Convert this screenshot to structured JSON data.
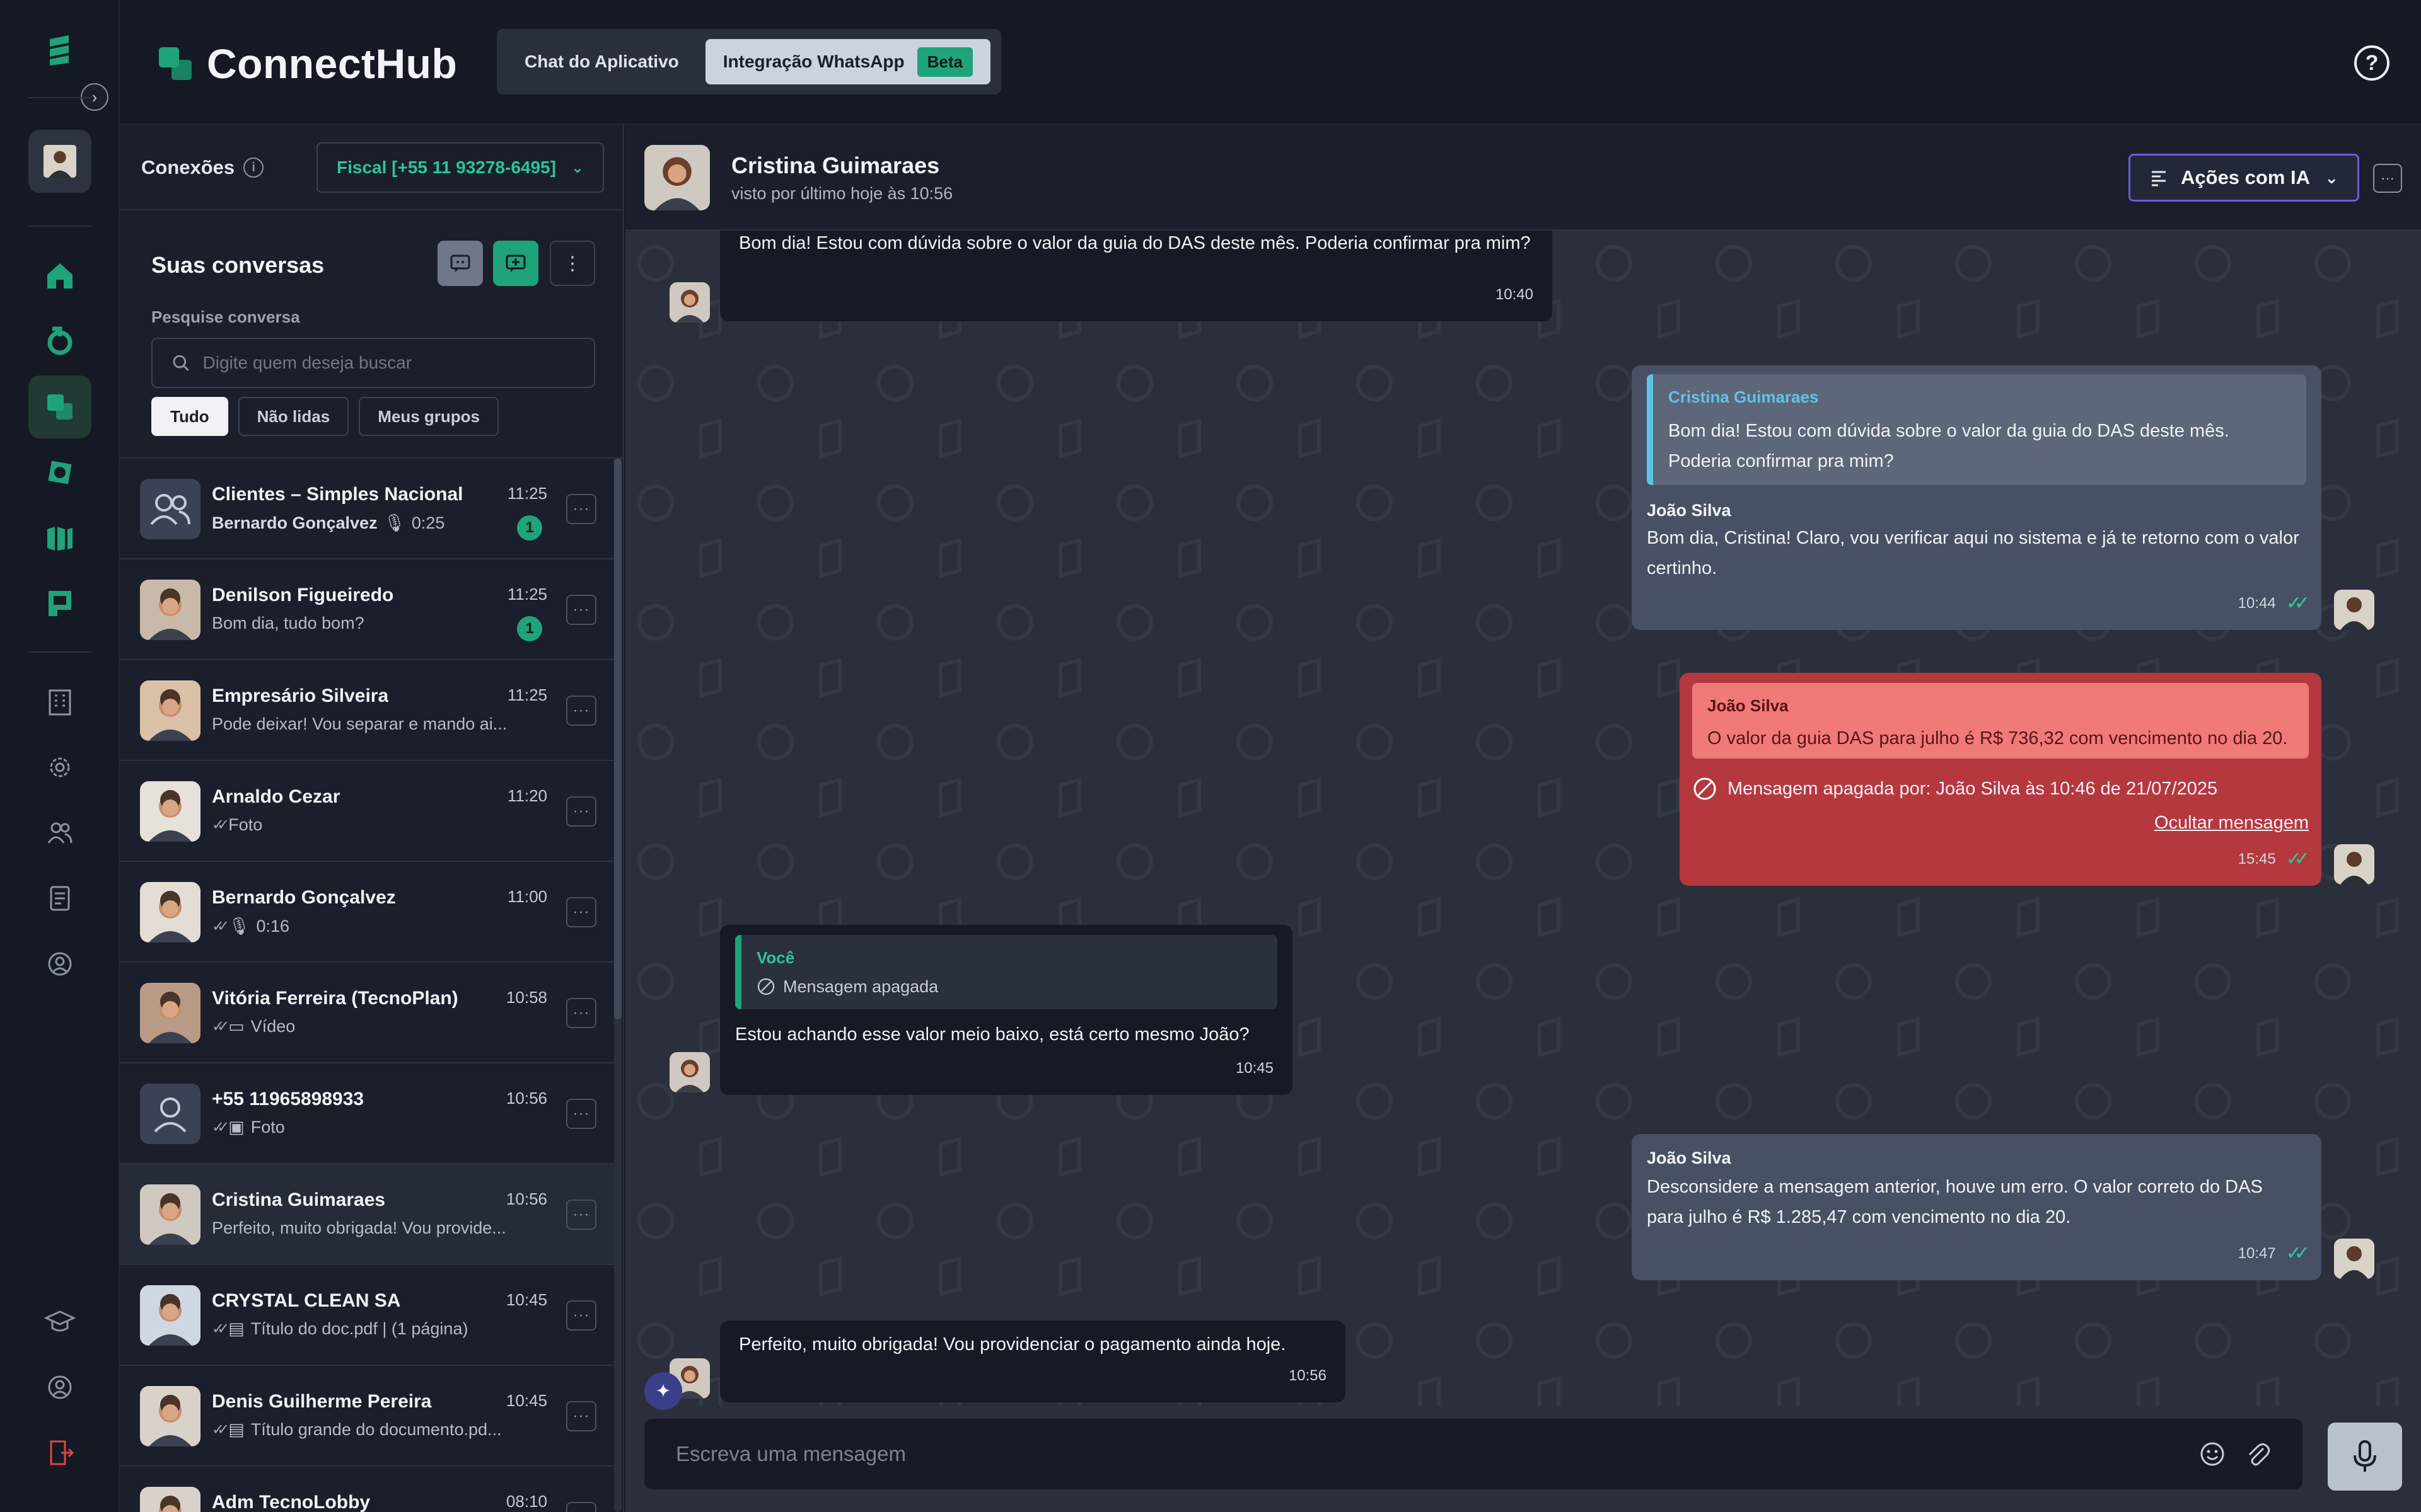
{
  "app": {
    "title": "ConnectHub",
    "colors": {
      "accent": "#1fa37a",
      "background": "#151923",
      "danger": "#b5383f",
      "ai": "#6b5ae0"
    }
  },
  "header": {
    "tabs": [
      {
        "label": "Chat do Aplicativo",
        "active": false
      },
      {
        "label": "Integração WhatsApp",
        "active": true,
        "badge": "Beta"
      }
    ],
    "help_icon": "help-circle-icon"
  },
  "rail": {
    "icons": [
      "logo-icon",
      "expand-icon",
      "user-avatar",
      "home-icon",
      "refresh-icon",
      "connecthub-icon",
      "cycle-icon",
      "board-icon",
      "chat-frame-icon",
      "building-icon",
      "gear-icon",
      "users-icon",
      "checklist-icon",
      "account-icon",
      "graduation-icon",
      "support-icon",
      "logout-icon"
    ]
  },
  "connections": {
    "label": "Conexões",
    "selected": "Fiscal [+55 11 93278-6495]"
  },
  "conversations": {
    "title": "Suas conversas",
    "search_label": "Pesquise conversa",
    "search_placeholder": "Digite quem deseja buscar",
    "filters": [
      "Tudo",
      "Não lidas",
      "Meus grupos"
    ],
    "items": [
      {
        "name": "Clientes – Simples Nacional",
        "sender": "Bernardo Gonçalvez",
        "preview": "0:25",
        "type": "audio",
        "time": "11:25",
        "unread": "1"
      },
      {
        "name": "Denilson Figueiredo",
        "sender": "",
        "preview": "Bom dia, tudo bom?",
        "type": "text",
        "time": "11:25",
        "unread": "1"
      },
      {
        "name": "Empresário Silveira",
        "sender": "",
        "preview": "Pode deixar! Vou separar e mando ai...",
        "type": "text",
        "time": "11:25",
        "unread": ""
      },
      {
        "name": "Arnaldo Cezar",
        "sender": "",
        "preview": "Foto",
        "type": "photo-sent",
        "time": "11:20",
        "unread": ""
      },
      {
        "name": "Bernardo Gonçalvez",
        "sender": "",
        "preview": "0:16",
        "type": "audio-sent",
        "time": "11:00",
        "unread": ""
      },
      {
        "name": "Vitória Ferreira (TecnoPlan)",
        "sender": "",
        "preview": "Vídeo",
        "type": "video-sent",
        "time": "10:58",
        "unread": ""
      },
      {
        "name": "+55 11965898933",
        "sender": "",
        "preview": "Foto",
        "type": "image-sent",
        "time": "10:56",
        "unread": ""
      },
      {
        "name": "Cristina Guimaraes",
        "sender": "",
        "preview": "Perfeito, muito obrigada! Vou provide...",
        "type": "text",
        "time": "10:56",
        "unread": ""
      },
      {
        "name": "CRYSTAL CLEAN SA",
        "sender": "",
        "preview": "Título do doc.pdf | (1 página)",
        "type": "doc-sent",
        "time": "10:45",
        "unread": ""
      },
      {
        "name": "Denis Guilherme Pereira",
        "sender": "",
        "preview": "Título grande do documento.pd...",
        "type": "doc-sent",
        "time": "10:45",
        "unread": ""
      },
      {
        "name": "Adm TecnoLobby",
        "sender": "",
        "preview": "",
        "type": "text",
        "time": "08:10",
        "unread": ""
      }
    ]
  },
  "chat": {
    "contact_name": "Cristina Guimaraes",
    "contact_status": "visto por último hoje às 10:56",
    "ai_actions": "Ações com IA",
    "messages": [
      {
        "dir": "in",
        "text": "Bom dia! Estou com dúvida sobre o valor da guia do DAS deste mês. Poderia confirmar pra mim?",
        "time": "10:40"
      },
      {
        "dir": "out",
        "quote_name": "Cristina Guimaraes",
        "quote_text": "Bom dia! Estou com dúvida sobre o valor da guia do DAS deste mês. Poderia confirmar pra mim?",
        "sender": "João Silva",
        "text": "Bom dia, Cristina! Claro, vou verificar aqui no sistema e já te retorno com o valor certinho.",
        "time": "10:44"
      },
      {
        "dir": "out-deleted",
        "quote_name": "João Silva",
        "quote_text": "O valor da guia DAS para julho é R$ 736,32 com vencimento no dia 20.",
        "text": "Mensagem apagada por: João Silva às 10:46 de 21/07/2025",
        "link": "Ocultar mensagem",
        "time": "15:45"
      },
      {
        "dir": "in",
        "quote_name": "Você",
        "quote_text": "Mensagem apagada",
        "text": "Estou achando esse valor meio baixo, está certo mesmo João?",
        "time": "10:45"
      },
      {
        "dir": "out",
        "sender": "João Silva",
        "text": "Desconsidere a mensagem anterior, houve um erro. O valor correto do DAS para julho é R$ 1.285,47 com vencimento no dia 20.",
        "time": "10:47"
      },
      {
        "dir": "in",
        "text": "Perfeito, muito obrigada! Vou providenciar o pagamento ainda hoje.",
        "time": "10:56"
      }
    ],
    "composer_placeholder": "Escreva uma mensagem"
  }
}
